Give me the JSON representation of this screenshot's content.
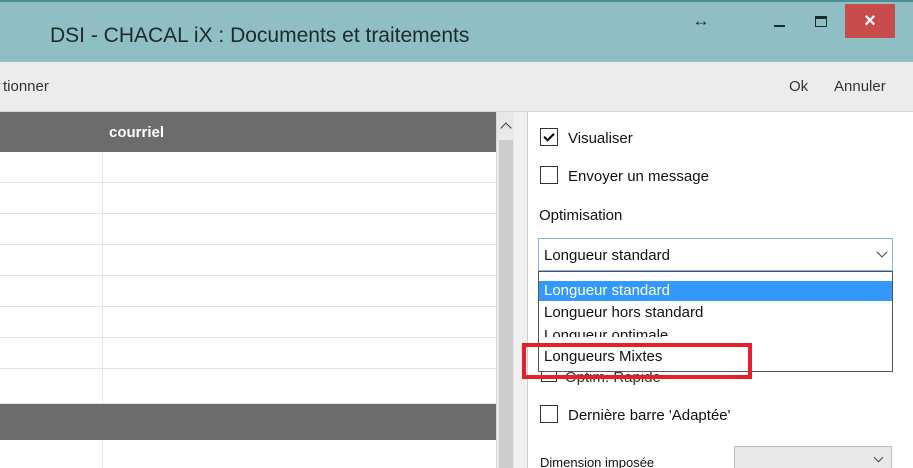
{
  "window": {
    "title": "DSI - CHACAL iX : Documents et traitements",
    "resize_icon": "↔",
    "minimize_icon": "minimize-icon",
    "maximize_icon": "maximize-icon",
    "close_icon": "×",
    "accent_color": "#8fbec4",
    "close_color": "#c84c4c"
  },
  "toolbar": {
    "left_label": "tionner",
    "ok_label": "Ok",
    "cancel_label": "Annuler"
  },
  "grid": {
    "column_header": "courriel",
    "rows": [
      "",
      "",
      "",
      "",
      "",
      "",
      "",
      ""
    ]
  },
  "options": {
    "visualiser": {
      "label": "Visualiser",
      "checked": true
    },
    "envoyer": {
      "label": "Envoyer un message",
      "checked": false
    },
    "optimisation_label": "Optimisation",
    "optimisation_selected": "Longueur standard",
    "optimisation_options": [
      "Longueur standard",
      "Longueur hors standard",
      "Longueur optimale",
      "Longueurs Mixtes"
    ],
    "optim_rapide": "Optim. Rapide",
    "derniere_barre": {
      "label": "Dernière barre 'Adaptée'",
      "checked": false
    },
    "dimension_label": "Dimension imposée",
    "dimension_value": ""
  },
  "highlight_color": "#e5202a"
}
